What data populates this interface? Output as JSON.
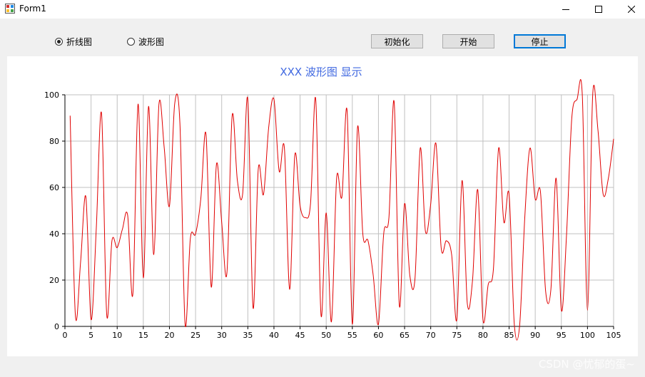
{
  "window": {
    "title": "Form1"
  },
  "controls": {
    "radio_line": {
      "label": "折线图",
      "checked": true
    },
    "radio_wave": {
      "label": "波形图",
      "checked": false
    },
    "init_button": "初始化",
    "start_button": "开始",
    "stop_button": "停止"
  },
  "watermark": "CSDN @忧郁的蛋~",
  "chart_data": {
    "type": "line",
    "title": "XXX 波形图 显示",
    "xlim": [
      0,
      105
    ],
    "ylim": [
      0,
      100
    ],
    "xticks": [
      0,
      5,
      10,
      15,
      20,
      25,
      30,
      35,
      40,
      45,
      50,
      55,
      60,
      65,
      70,
      75,
      80,
      85,
      90,
      95,
      100,
      105
    ],
    "yticks": [
      0,
      20,
      40,
      60,
      80,
      100
    ],
    "grid": true,
    "colors": {
      "line": "#e00000",
      "title": "#4169e1",
      "grid": "#c0c0c0"
    },
    "series": [
      {
        "x": [
          1,
          2,
          3,
          4,
          5,
          6,
          7,
          8,
          9,
          10,
          11,
          12,
          13,
          14,
          15,
          16,
          17,
          18,
          19,
          20,
          21,
          22,
          23,
          24,
          25,
          26,
          27,
          28,
          29,
          30,
          31,
          32,
          33,
          34,
          35,
          36,
          37,
          38,
          39,
          40,
          41,
          42,
          43,
          44,
          45,
          46,
          47,
          48,
          49,
          50,
          51,
          52,
          53,
          54,
          55,
          56,
          57,
          58,
          59,
          60,
          61,
          62,
          63,
          64,
          65,
          66,
          67,
          68,
          69,
          70,
          71,
          72,
          73,
          74,
          75,
          76,
          77,
          78,
          79,
          80,
          81,
          82,
          83,
          84,
          85,
          86,
          87,
          88,
          89,
          90,
          91,
          92,
          93,
          94,
          95,
          96,
          97,
          98,
          99,
          100,
          101,
          102,
          103,
          104,
          105
        ],
        "values": [
          91,
          5,
          28,
          56,
          3,
          42,
          92,
          5,
          37,
          34,
          42,
          48,
          14,
          96,
          21,
          95,
          31,
          96,
          77,
          52,
          96,
          88,
          1,
          38,
          40,
          55,
          83,
          17,
          70,
          45,
          23,
          91,
          63,
          57,
          98,
          8,
          68,
          57,
          86,
          98,
          67,
          77,
          16,
          74,
          52,
          47,
          53,
          98,
          5,
          49,
          2,
          64,
          56,
          93,
          1,
          86,
          40,
          37,
          22,
          1,
          40,
          47,
          97,
          9,
          53,
          22,
          21,
          77,
          41,
          53,
          79,
          34,
          37,
          31,
          3,
          63,
          10,
          20,
          59,
          3,
          18,
          25,
          77,
          45,
          57,
          1,
          0,
          47,
          77,
          55,
          58,
          15,
          16,
          64,
          7,
          40,
          90,
          98,
          100,
          7,
          100,
          85,
          57,
          64,
          81
        ]
      }
    ]
  }
}
